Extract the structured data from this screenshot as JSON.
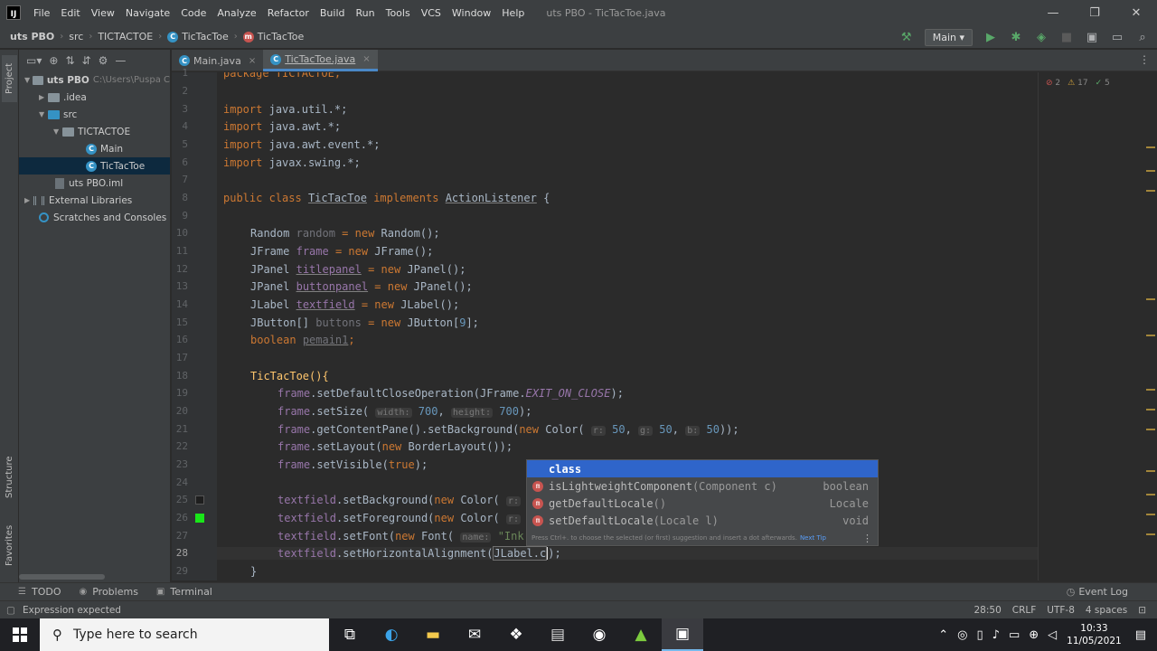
{
  "menu": {
    "items": [
      "File",
      "Edit",
      "View",
      "Navigate",
      "Code",
      "Analyze",
      "Refactor",
      "Build",
      "Run",
      "Tools",
      "VCS",
      "Window",
      "Help"
    ],
    "window_title": "uts PBO - TicTacToe.java"
  },
  "window_controls": {
    "minimize": "—",
    "maximize": "❐",
    "close": "✕"
  },
  "breadcrumbs": [
    "uts PBO",
    "src",
    "TICTACTOE",
    "TicTacToe",
    "TicTacToe"
  ],
  "run_config": "Main ▾",
  "left_strip": {
    "project": "Project",
    "structure": "Structure",
    "favorites": "Favorites"
  },
  "project_tree": {
    "root_label": "uts PBO",
    "root_path": "C:\\Users\\Puspa C",
    "idea": ".idea",
    "src": "src",
    "package": "TICTACTOE",
    "main": "Main",
    "tictactoe": "TicTacToe",
    "iml": "uts PBO.iml",
    "ext_libs": "External Libraries",
    "scratches": "Scratches and Consoles"
  },
  "editor_tabs": [
    {
      "label": "Main.java",
      "active": false
    },
    {
      "label": "TicTacToe.java",
      "active": true
    }
  ],
  "line_numbers": [
    "1",
    "2",
    "3",
    "4",
    "5",
    "6",
    "7",
    "8",
    "9",
    "10",
    "11",
    "12",
    "13",
    "14",
    "15",
    "16",
    "17",
    "18",
    "19",
    "20",
    "21",
    "22",
    "23",
    "24",
    "25",
    "26",
    "27",
    "28",
    "29"
  ],
  "inspections": {
    "errors": "2",
    "warnings": "17",
    "weak": "5"
  },
  "code": {
    "l1": "package TICTACTOE;",
    "import": "import",
    "l3": "java.util.*;",
    "l4": "java.awt.*;",
    "l5": "java.awt.event.*;",
    "l6": "javax.swing.*;",
    "public_class": "public class",
    "class_name": "TicTacToe",
    "implements": "implements",
    "iface": "ActionListener",
    "brace_open": " {",
    "l10_type": "Random",
    "l10_name": "random",
    "l10_rest": "Random();",
    "l11_type": "JFrame",
    "l11_name": "frame",
    "l11_rest": "JFrame();",
    "l12_type": "JPanel",
    "l12_name": "titlepanel",
    "l12_rest": "JPanel();",
    "l13_type": "JPanel",
    "l13_name": "buttonpanel",
    "l13_rest": "JPanel();",
    "l14_type": "JLabel",
    "l14_name": "textfield",
    "l14_rest": "JLabel();",
    "l15_type": "JButton[]",
    "l15_name": "buttons",
    "l15_rest": "JButton[",
    "l15_num": "9",
    "l15_end": "];",
    "l16_type": "boolean",
    "l16_name": "pemain1",
    "assign_new": " = new ",
    "new": "new",
    "l18": "TicTacToe(){",
    "frame": "frame",
    "l19_call": ".setDefaultCloseOperation(JFrame.",
    "l19_const": "EXIT_ON_CLOSE",
    "l19_end": ");",
    "l20_call": ".setSize(",
    "hint_width": "width:",
    "num_700": "700",
    "hint_height": "height:",
    "l21_call": ".getContentPane().setBackground(",
    "color_ctor": "Color(",
    "hint_r": "r:",
    "hint_g": "g:",
    "hint_b": "b:",
    "num_50": "50",
    "l21_end": "));",
    "l22_call": ".setLayout(",
    "l22_rest": "BorderLayout());",
    "l23_call": ".setVisible(",
    "true": "true",
    "l23_end": ");",
    "textfield": "textfield",
    "l25_call": ".setBackground(",
    "l26_call": ".setForeground(",
    "l27_call": ".setFont(",
    "font_ctor": "Font(",
    "hint_name": "name:",
    "l27_str": "\"Ink",
    "l28_call": ".setHorizontalAlignment(",
    "l28_arg": "JLabel.c",
    "l28_end": ");",
    "l29": "}"
  },
  "completion": {
    "items": [
      {
        "icon": "",
        "name": "class",
        "params": "",
        "type": ""
      },
      {
        "icon": "m",
        "name": "isLightweightComponent",
        "params": "(Component c)",
        "type": "boolean"
      },
      {
        "icon": "m",
        "name": "getDefaultLocale",
        "params": "()",
        "type": "Locale"
      },
      {
        "icon": "m",
        "name": "setDefaultLocale",
        "params": "(Locale l)",
        "type": "void"
      }
    ],
    "footer": "Press Ctrl+. to choose the selected (or first) suggestion and insert a dot afterwards.",
    "footer_link": "Next Tip",
    "more": "⋮"
  },
  "tool_tabs": {
    "todo": "TODO",
    "problems": "Problems",
    "terminal": "Terminal",
    "event_log": "Event Log"
  },
  "status": {
    "message": "Expression expected",
    "position": "28:50",
    "line_sep": "CRLF",
    "encoding": "UTF-8",
    "indent": "4 spaces"
  },
  "taskbar": {
    "search_placeholder": "Type here to search",
    "time": "10:33",
    "date": "11/05/2021"
  },
  "colors": {
    "accent": "#4a88c7",
    "selection": "#2f65ca",
    "keyword": "#cc7832",
    "field": "#9876aa"
  }
}
